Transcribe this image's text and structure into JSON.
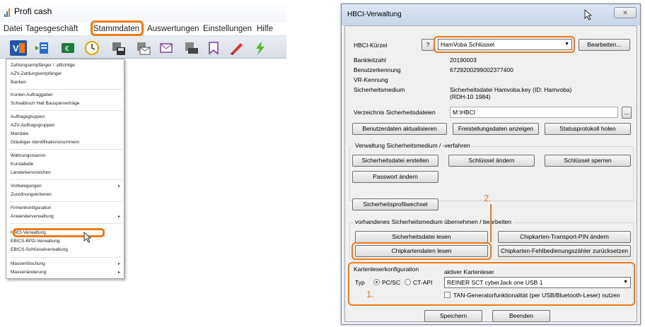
{
  "app": {
    "title": "Profi cash",
    "menu": [
      "Datei",
      "Tagesgeschäft",
      "Stammdaten",
      "Auswertungen",
      "Einstellungen",
      "Hilfe"
    ],
    "dropdown": [
      {
        "label": "Zahlungsempfänger / -pflichtige",
        "sub": false
      },
      {
        "label": "AZV-Zahlungsempfänger",
        "sub": false
      },
      {
        "label": "Banken",
        "sub": false
      },
      {
        "label": "Konten Auftraggeber",
        "sub": false
      },
      {
        "label": "Schwäbisch Hall Bausparverträge",
        "sub": false
      },
      {
        "label": "Auftragsgruppen",
        "sub": false
      },
      {
        "label": "AZV-Auftragsgruppen",
        "sub": false
      },
      {
        "label": "Mandate",
        "sub": false
      },
      {
        "label": "Gläubiger-Identifikationsnummern",
        "sub": false
      },
      {
        "label": "Währungsstamm",
        "sub": false
      },
      {
        "label": "Kurstabelle",
        "sub": false
      },
      {
        "label": "Länderkennzeichen",
        "sub": false
      },
      {
        "label": "Vorbelegungen",
        "sub": true
      },
      {
        "label": "Zuordnungskriterien",
        "sub": false
      },
      {
        "label": "Firmenkonfiguration",
        "sub": false
      },
      {
        "label": "Anwenderverwaltung",
        "sub": true
      },
      {
        "label": "HBCI-Verwaltung",
        "sub": false
      },
      {
        "label": "EBICS-BPD-Verwaltung",
        "sub": false
      },
      {
        "label": "EBICS-Schlüsselverwaltung",
        "sub": false
      },
      {
        "label": "Massenlöschung",
        "sub": true
      },
      {
        "label": "Massenänderung",
        "sub": true
      }
    ],
    "submenu_arrow": "▸"
  },
  "dialog": {
    "title": "HBCI-Verwaltung",
    "close": "✕",
    "kuerzel_label": "HBCI-Kürzel",
    "help": "?",
    "kuerzel_value": "HamVoba Schlüssel",
    "bearbeiten": "Bearbeiten...",
    "rows": [
      {
        "label": "Bankleitzahl",
        "value": "20190003"
      },
      {
        "label": "Benutzerkennung",
        "value": "6729200299002377400"
      },
      {
        "label": "VR-Kennung",
        "value": ""
      },
      {
        "label": "Sicherheitsmedium",
        "value": "Sicherheitsdatei Hamvoba.key  (ID: Hamvoba)"
      }
    ],
    "sicherheit_line2": "(RDH-10  1984)",
    "verzeichnis_label": "Verzeichnis Sicherheitsdateien",
    "verzeichnis_value": "M:\\HBCI",
    "browse": "...",
    "btn_benutzerdaten": "Benutzerdaten aktualisieren",
    "btn_freistellung": "Freistellungsdaten anzeigen",
    "btn_status": "Statusprotokoll holen",
    "grp_verwaltung": "Verwaltung Sicherheitsmedium / -verfahren",
    "btn_erstellen": "Sicherheitsdatei erstellen",
    "btn_schl_aendern": "Schlüssel ändern",
    "btn_schl_sperren": "Schlüssel sperren",
    "btn_passwort": "Passwort ändern",
    "btn_profilwechsel": "Sicherheitsprofilwechsel",
    "grp_uebernehmen": "vorhandenes Sicherheitsmedium übernehmen / bearbeiten",
    "btn_datei_lesen": "Sicherheitsdatei lesen",
    "btn_transport_pin": "Chipkarten-Transport-PIN ändern",
    "btn_chip_lesen": "Chipkartendaten lesen",
    "btn_fehlbed": "Chipkarten-Fehlbedienungszähler zurücksetzen",
    "grp_leser": "Kartenleserkonfiguration",
    "typ_label": "Typ",
    "radio_pcsc": "PC/SC",
    "radio_ctapi": "CT-API",
    "aktiv_label": "aktiver Kartenleser",
    "leser_value": "REINER SCT cyberJack one USB 1",
    "tan_label": "TAN-Generatorfunktionalität (per USB/Bluetooth-Leser) nutzen",
    "btn_speichern": "Speichern",
    "btn_beenden": "Beenden",
    "step1": "1.",
    "step2": "2."
  },
  "colors": {
    "highlight": "#f07a18",
    "accent": "#1f5fbf"
  }
}
